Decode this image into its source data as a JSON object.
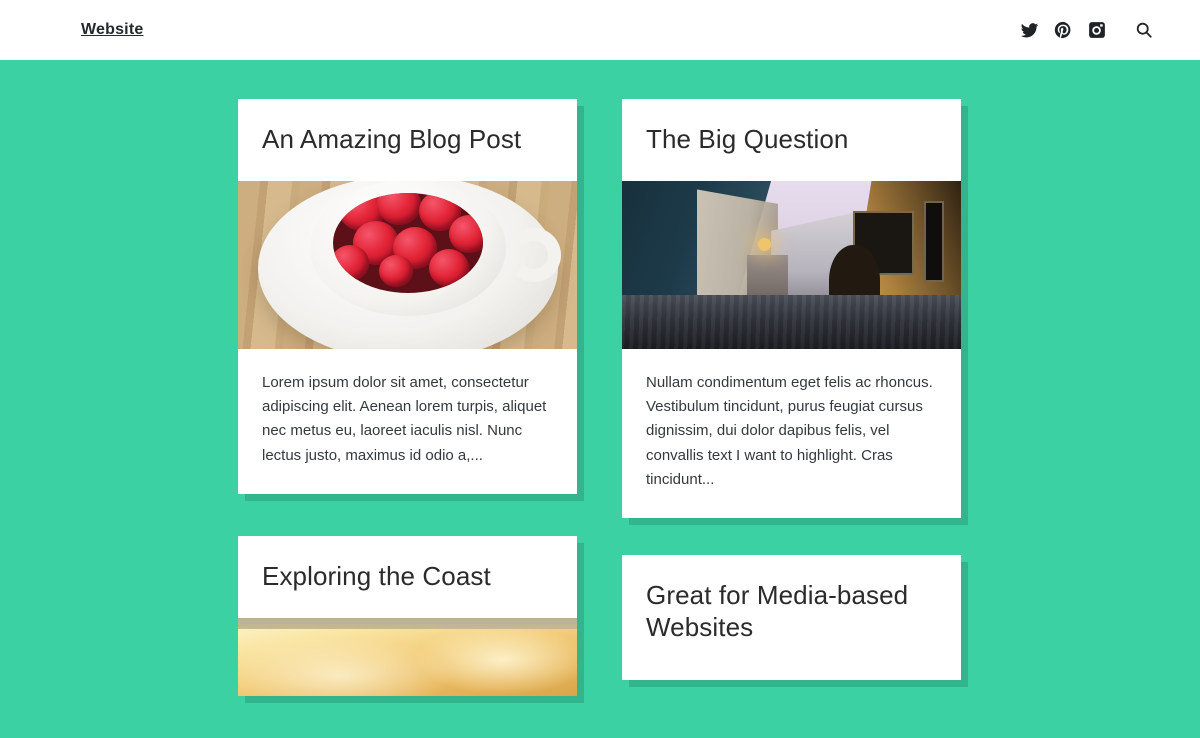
{
  "header": {
    "brand": "Website",
    "social": [
      {
        "name": "twitter-icon",
        "label": "Twitter"
      },
      {
        "name": "pinterest-icon",
        "label": "Pinterest"
      },
      {
        "name": "instagram-icon",
        "label": "Instagram"
      }
    ],
    "search": {
      "name": "search-icon",
      "label": "Search"
    }
  },
  "theme": {
    "background": "#3BD1A3",
    "card_background": "#FFFFFF",
    "text": "#2B2B2B",
    "body_text": "#33393D",
    "shadow": "#2A8C6C"
  },
  "columns": {
    "left": [
      {
        "title": "An Amazing Blog Post",
        "image": "raspberries-in-white-cup-on-wood",
        "excerpt": "Lorem ipsum dolor sit amet, consectetur adipiscing elit. Aenean lorem turpis, aliquet nec metus eu, laoreet iaculis nisl. Nunc lectus justo, maximus id odio a,..."
      },
      {
        "title": "Exploring the Coast",
        "image": "golden-sand-coast",
        "excerpt": ""
      }
    ],
    "right": [
      {
        "title": "The Big Question",
        "image": "european-street-at-dusk",
        "excerpt": "Nullam condimentum eget felis ac rhoncus. Vestibulum tincidunt, purus feugiat cursus dignissim, dui dolor dapibus felis, vel convallis text I want to highlight. Cras tincidunt..."
      },
      {
        "title": "Great for Media-based Websites",
        "image": "",
        "excerpt": ""
      }
    ]
  }
}
